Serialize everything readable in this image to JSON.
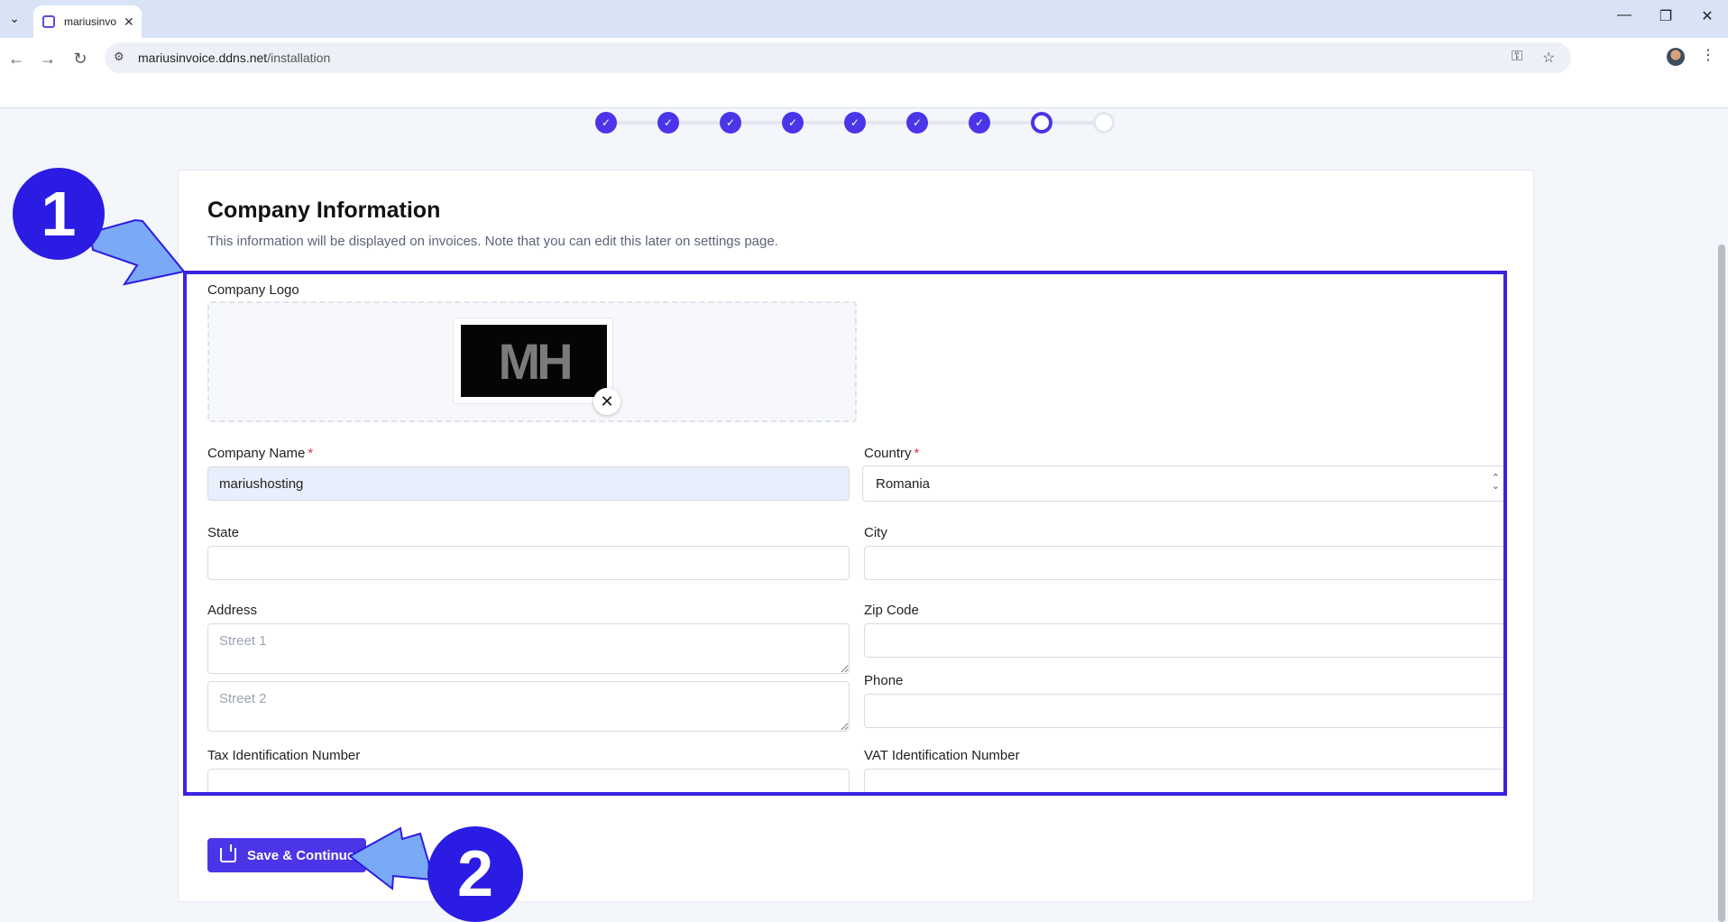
{
  "browser": {
    "tab_title": "mariusinvoice",
    "url_host": "mariusinvoice.ddns.net",
    "url_path": "/installation"
  },
  "stepper": {
    "completed_steps": 7,
    "current_step": 8,
    "total_steps": 9
  },
  "form": {
    "title": "Company Information",
    "description": "This information will be displayed on invoices. Note that you can edit this later on settings page.",
    "logo_label": "Company Logo",
    "logo_text": "MH",
    "company_name_label": "Company Name",
    "company_name_value": "mariushosting",
    "country_label": "Country",
    "country_value": "Romania",
    "state_label": "State",
    "city_label": "City",
    "address_label": "Address",
    "street1_placeholder": "Street 1",
    "street2_placeholder": "Street 2",
    "zip_label": "Zip Code",
    "phone_label": "Phone",
    "tax_label": "Tax Identification Number",
    "vat_label": "VAT Identification Number",
    "required_mark": "*",
    "save_button": "Save & Continue"
  },
  "annotations": {
    "callout_1": "1",
    "callout_2": "2",
    "accent_color": "#2b1ce3",
    "arrow_color": "#7aa9f5"
  },
  "colors": {
    "primary": "#4b35e8",
    "page_bg": "#f3f6fa"
  }
}
